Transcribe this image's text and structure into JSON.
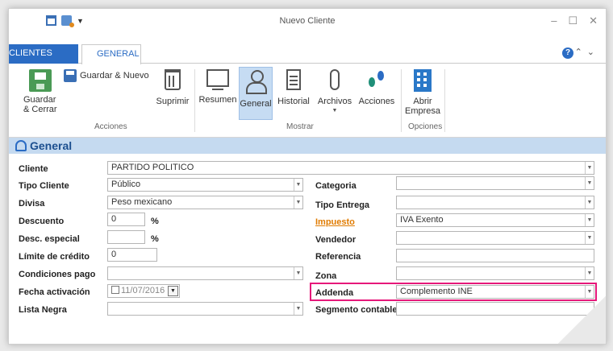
{
  "window": {
    "title": "Nuevo Cliente"
  },
  "tabs": {
    "file": "CLIENTES",
    "general": "GENERAL"
  },
  "ribbon": {
    "guardar": "Guardar\n& Cerrar",
    "guardar_nuevo": "Guardar & Nuevo",
    "suprimir": "Suprimir",
    "acciones_group": "Acciones",
    "resumen": "Resumen",
    "general": "General",
    "historial": "Historial",
    "archivos": "Archivos",
    "acciones": "Acciones",
    "mostrar_group": "Mostrar",
    "abrir_empresa": "Abrir\nEmpresa",
    "opciones_group": "Opciones"
  },
  "section": {
    "title": "General"
  },
  "form": {
    "cliente": {
      "label": "Cliente",
      "value": "PARTIDO POLITICO"
    },
    "tipo_cliente": {
      "label": "Tipo Cliente",
      "value": "Público"
    },
    "divisa": {
      "label": "Divisa",
      "value": "Peso mexicano"
    },
    "descuento": {
      "label": "Descuento",
      "value": "0",
      "unit": "%"
    },
    "desc_especial": {
      "label": "Desc. especial",
      "value": "",
      "unit": "%"
    },
    "limite_credito": {
      "label": "Límite de crédito",
      "value": "0"
    },
    "condiciones_pago": {
      "label": "Condiciones pago",
      "value": ""
    },
    "fecha_activacion": {
      "label": "Fecha activación",
      "value": "11/07/2016"
    },
    "lista_negra": {
      "label": "Lista Negra",
      "value": ""
    },
    "categoria": {
      "label": "Categoria",
      "value": ""
    },
    "tipo_entrega": {
      "label": "Tipo Entrega",
      "value": ""
    },
    "impuesto": {
      "label": "Impuesto",
      "value": "IVA Exento"
    },
    "vendedor": {
      "label": "Vendedor",
      "value": ""
    },
    "referencia": {
      "label": "Referencia",
      "value": ""
    },
    "zona": {
      "label": "Zona",
      "value": ""
    },
    "addenda": {
      "label": "Addenda",
      "value": "Complemento INE"
    },
    "segmento_contable": {
      "label": "Segmento contable",
      "value": ""
    }
  },
  "colors": {
    "accent": "#2b6cc4",
    "highlight": "#e6187a",
    "link": "#e07b00",
    "section_bg": "#c5daf0"
  }
}
